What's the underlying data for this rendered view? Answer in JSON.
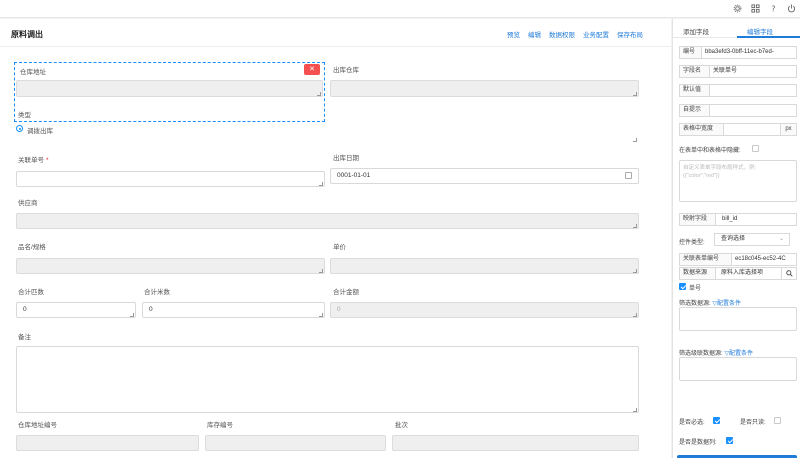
{
  "topbar": {
    "icons": [
      "gear-icon",
      "grid-icon",
      "help-icon",
      "power-icon"
    ]
  },
  "main": {
    "title": "原料调出",
    "actions": [
      "预览",
      "编辑",
      "数据权限",
      "业务配置",
      "保存布局"
    ],
    "delete_symbol": "✕",
    "fields": {
      "warehouse_addr": "仓库地址",
      "out_warehouse": "出库仓库",
      "type": "类型",
      "type_option": "调拨出库",
      "bill_no": "关联单号",
      "required_mark": "*",
      "out_date": "出库日期",
      "out_date_value": "0001-01-01",
      "supplier": "供应商",
      "product_spec": "品名/规格",
      "unit_price": "单价",
      "total_pieces": "合计匹数",
      "total_pieces_value": "0",
      "total_meters": "合计米数",
      "total_meters_value": "0",
      "total_amount": "合计金额",
      "total_amount_value": "0",
      "remark": "备注",
      "warehouse_addr_no": "仓库地址编号",
      "stock_no": "库存编号",
      "batch": "批次"
    }
  },
  "panel": {
    "tabs": [
      "添加字段",
      "编辑字段"
    ],
    "active_tab": 1,
    "id_label": "编号",
    "id_value": "bba3efd3-0bff-11ec-b7ed-",
    "field_name_label": "字段名",
    "field_name_value": "关联单号",
    "default_label": "默认值",
    "hint_label": "自提示",
    "width_label": "表格中宽度",
    "width_unit": "px",
    "hidden_label": "在表单中和表格中隐藏:",
    "style_placeholder": "自定义表单字段布局样式，例: ({\"color\":\"red\"})",
    "map_label": "映射字段",
    "map_value": "bill_id",
    "control_type_label": "控件类型:",
    "control_type_value": "查询选择",
    "rel_form_label": "关联表单编号",
    "rel_form_value": "ec18c045-ec52-4C",
    "source_label": "数据来源",
    "source_value": "原料入库选择项",
    "single_label": "单号",
    "filter_src_label": "筛选数据源:",
    "filter_src_link": "▽配置条件",
    "filter_cascade_label": "筛选级联数据源:",
    "filter_cascade_link": "▽配置条件",
    "required_label": "是否必选:",
    "readonly_label": "是否只读:",
    "datacol_label": "是否是数据列:"
  }
}
